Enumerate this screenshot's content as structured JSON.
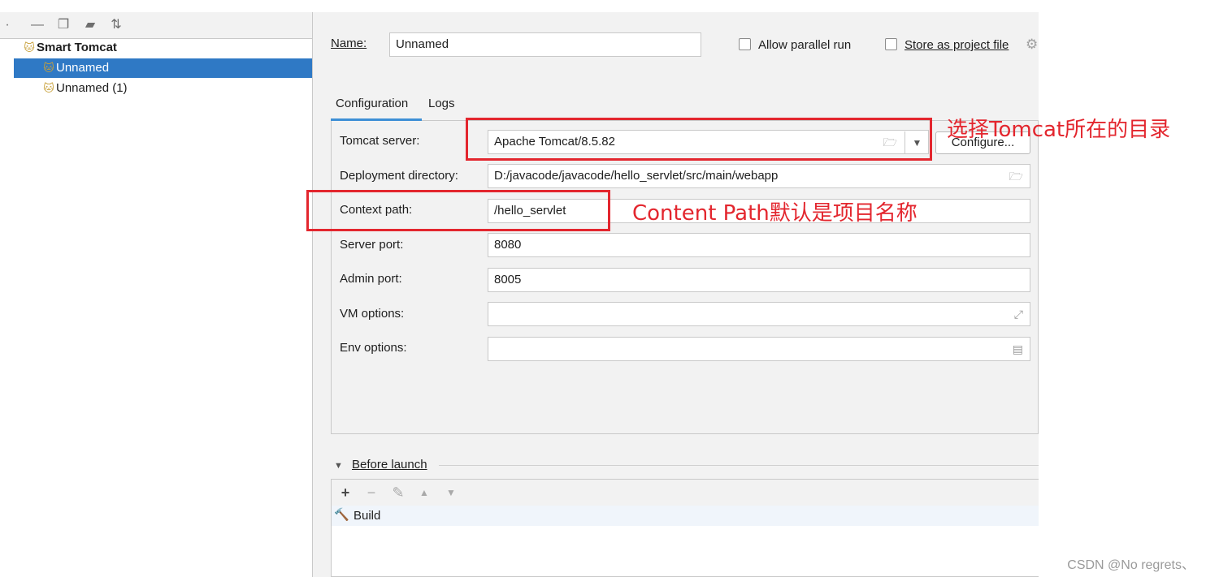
{
  "tree": {
    "group_label": "Smart Tomcat",
    "items": [
      {
        "label": "Unnamed",
        "selected": true
      },
      {
        "label": "Unnamed (1)",
        "selected": false
      }
    ]
  },
  "form": {
    "name_label": "Name:",
    "name_value": "Unnamed",
    "allow_parallel_label": "Allow parallel run",
    "allow_parallel_checked": false,
    "store_project_label": "Store as project file",
    "store_project_checked": false
  },
  "tabs": [
    "Configuration",
    "Logs"
  ],
  "config": {
    "tomcat_server_label": "Tomcat server:",
    "tomcat_server_value": "Apache Tomcat/8.5.82",
    "configure_button": "Configure...",
    "deployment_label": "Deployment directory:",
    "deployment_value": "D:/javacode/javacode/hello_servlet/src/main/webapp",
    "context_label": "Context path:",
    "context_value": "/hello_servlet",
    "server_port_label": "Server port:",
    "server_port_value": "8080",
    "admin_port_label": "Admin port:",
    "admin_port_value": "8005",
    "vm_label": "VM options:",
    "vm_value": "",
    "env_label": "Env options:",
    "env_value": ""
  },
  "before_launch": {
    "title": "Before launch",
    "items": [
      "Build"
    ]
  },
  "annotations": {
    "tomcat_note": "选择Tomcat所在的目录",
    "context_note": "Content Path默认是项目名称"
  },
  "watermark": "CSDN @No regrets、",
  "colors": {
    "selection": "#2f79c5",
    "annotation_red": "#e3262e",
    "tab_underline": "#3d8fd6",
    "panel_bg": "#f2f2f2"
  }
}
